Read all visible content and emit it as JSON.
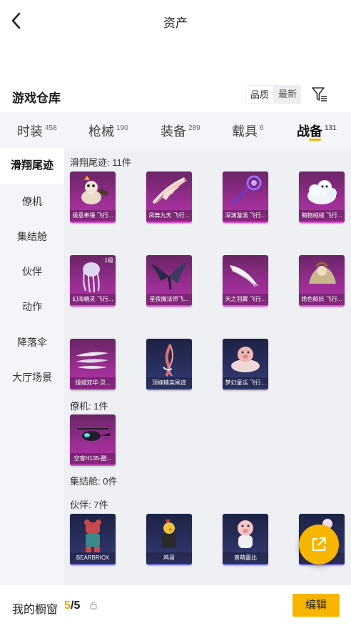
{
  "header": {
    "title": "资产"
  },
  "warehouse": {
    "title": "游戏仓库",
    "sort_options": [
      "品质",
      "最新"
    ]
  },
  "tabs": [
    {
      "label": "时装",
      "count": "458"
    },
    {
      "label": "枪械",
      "count": "190"
    },
    {
      "label": "装备",
      "count": "289"
    },
    {
      "label": "载具",
      "count": "6"
    },
    {
      "label": "战备",
      "count": "131"
    }
  ],
  "sidenav": [
    "滑翔尾迹",
    "僚机",
    "集结舱",
    "伙伴",
    "动作",
    "降落伞",
    "大厅场景"
  ],
  "sections": {
    "glide": "滑翔尾迹: 11件",
    "wingman": "僚机: 1件",
    "pod": "集结舱: 0件",
    "partner": "伙伴: 7件"
  },
  "items": {
    "glide": [
      {
        "name": "极意奉锤 飞行...",
        "rarity": "purple",
        "icon": "hammer-creature-icon"
      },
      {
        "name": "凤舞九天 飞行...",
        "rarity": "purple",
        "icon": "phoenix-feather-icon"
      },
      {
        "name": "深渊漩涡 飞行...",
        "rarity": "purple",
        "icon": "vortex-staff-icon"
      },
      {
        "name": "萌物绒绒 飞行...",
        "rarity": "purple",
        "icon": "fluffy-cloud-icon"
      },
      {
        "name": "幻海精灵 飞行...",
        "rarity": "purple",
        "icon": "jellyfish-icon",
        "level": "1级"
      },
      {
        "name": "星夜魔法师飞...",
        "rarity": "purple",
        "icon": "dark-wings-icon"
      },
      {
        "name": "天之羽翼 飞行...",
        "rarity": "purple",
        "icon": "white-wing-icon"
      },
      {
        "name": "绝色鲸妖 飞行...",
        "rarity": "purple",
        "icon": "whale-spirit-icon"
      },
      {
        "name": "镜城双华·灵...",
        "rarity": "purple",
        "icon": "blade-feathers-icon"
      },
      {
        "name": "顶峰精英尾迹",
        "rarity": "blue",
        "icon": "flame-trail-icon"
      },
      {
        "name": "梦幻童话 飞行...",
        "rarity": "blue",
        "icon": "pig-float-icon"
      }
    ],
    "wingman": [
      {
        "name": "空客H135-酷...",
        "rarity": "purple",
        "icon": "helicopter-icon"
      }
    ],
    "partner": [
      {
        "name": "BEARBRICK",
        "rarity": "blue",
        "icon": "bearbrick-icon"
      },
      {
        "name": "鸡哥",
        "rarity": "blue",
        "icon": "chicken-icon"
      },
      {
        "name": "普萌露比",
        "rarity": "blue",
        "icon": "pink-pig-icon"
      },
      {
        "name": "",
        "rarity": "blue",
        "icon": "partner-icon"
      }
    ]
  },
  "bottom": {
    "showcase_label": "我的橱窗",
    "count_current": "5",
    "count_total": "/5",
    "edit_label": "编辑"
  },
  "colors": {
    "accent": "#f7b500",
    "purple": "#9c2e94",
    "blue": "#2a3060"
  }
}
